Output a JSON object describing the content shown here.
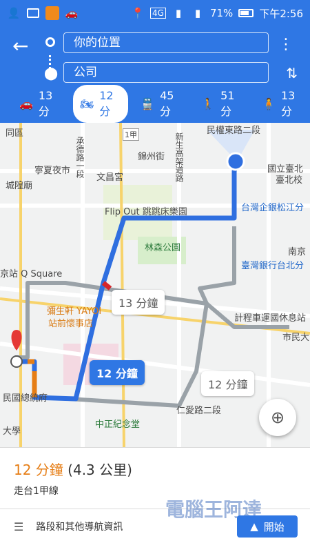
{
  "status_bar": {
    "battery": "71%",
    "network": "4G",
    "time": "下午2:56"
  },
  "search": {
    "origin": "你的位置",
    "destination": "公司"
  },
  "modes": [
    {
      "icon": "car-icon",
      "label": "13 分",
      "active": false
    },
    {
      "icon": "motorcycle-icon",
      "label": "12 分",
      "active": true
    },
    {
      "icon": "train-icon",
      "label": "45 分",
      "active": false
    },
    {
      "icon": "walk-icon",
      "label": "51 分",
      "active": false
    },
    {
      "icon": "ride-icon",
      "label": "13 分",
      "active": false
    }
  ],
  "map": {
    "labels": [
      {
        "name": "label-tongqu",
        "text": "同區"
      },
      {
        "name": "label-ningxia",
        "text": "寧夏夜市"
      },
      {
        "name": "label-chenghuang",
        "text": "城隍廟"
      },
      {
        "name": "label-wenchang",
        "text": "文昌宮"
      },
      {
        "name": "label-jinzhou",
        "text": "錦州街"
      },
      {
        "name": "label-chengde",
        "text": "承德路一段"
      },
      {
        "name": "label-xinsheng",
        "text": "新生高架道路"
      },
      {
        "name": "label-minquan",
        "text": "民權東路二段"
      },
      {
        "name": "label-guoli",
        "text": "國立臺北"
      },
      {
        "name": "label-taibei",
        "text": "臺北校"
      },
      {
        "name": "label-flipout",
        "text": "Flip Out 跳跳床樂園"
      },
      {
        "name": "label-linsen",
        "text": "林森公園"
      },
      {
        "name": "label-taiwan-bank",
        "text": "台灣企銀松江分"
      },
      {
        "name": "label-nanjing",
        "text": "南京"
      },
      {
        "name": "label-taiwan-bank2",
        "text": "臺灣銀行台北分"
      },
      {
        "name": "label-qsquare",
        "text": "京站 Q Square"
      },
      {
        "name": "label-yayoi",
        "text": "彌生軒 YAYOI"
      },
      {
        "name": "label-yayoi2",
        "text": "站前懷事店"
      },
      {
        "name": "label-taxi",
        "text": "計程車運國休息站"
      },
      {
        "name": "label-shimin",
        "text": "市民大"
      },
      {
        "name": "label-zongtong",
        "text": "民國總統府"
      },
      {
        "name": "label-renai",
        "text": "仁愛路二段"
      },
      {
        "name": "label-zhongzheng",
        "text": "中正紀念堂"
      },
      {
        "name": "label-daxue",
        "text": "大學"
      },
      {
        "name": "label-route1",
        "text": "1甲"
      }
    ],
    "callouts": [
      {
        "text": "13 分鐘"
      },
      {
        "text": "12 分鐘"
      },
      {
        "text": "12 分鐘"
      }
    ]
  },
  "summary": {
    "duration": "12 分鐘",
    "distance": "(4.3 公里)",
    "via": "走台1甲線",
    "steps_label": "路段和其他導航資訊",
    "start_label": "開始",
    "watermark": "電腦王阿達"
  },
  "colors": {
    "header_blue": "#2f77e4",
    "route_blue": "#2f6fe0",
    "route_gray": "#9aa2a8",
    "orange": "#e67e16"
  }
}
